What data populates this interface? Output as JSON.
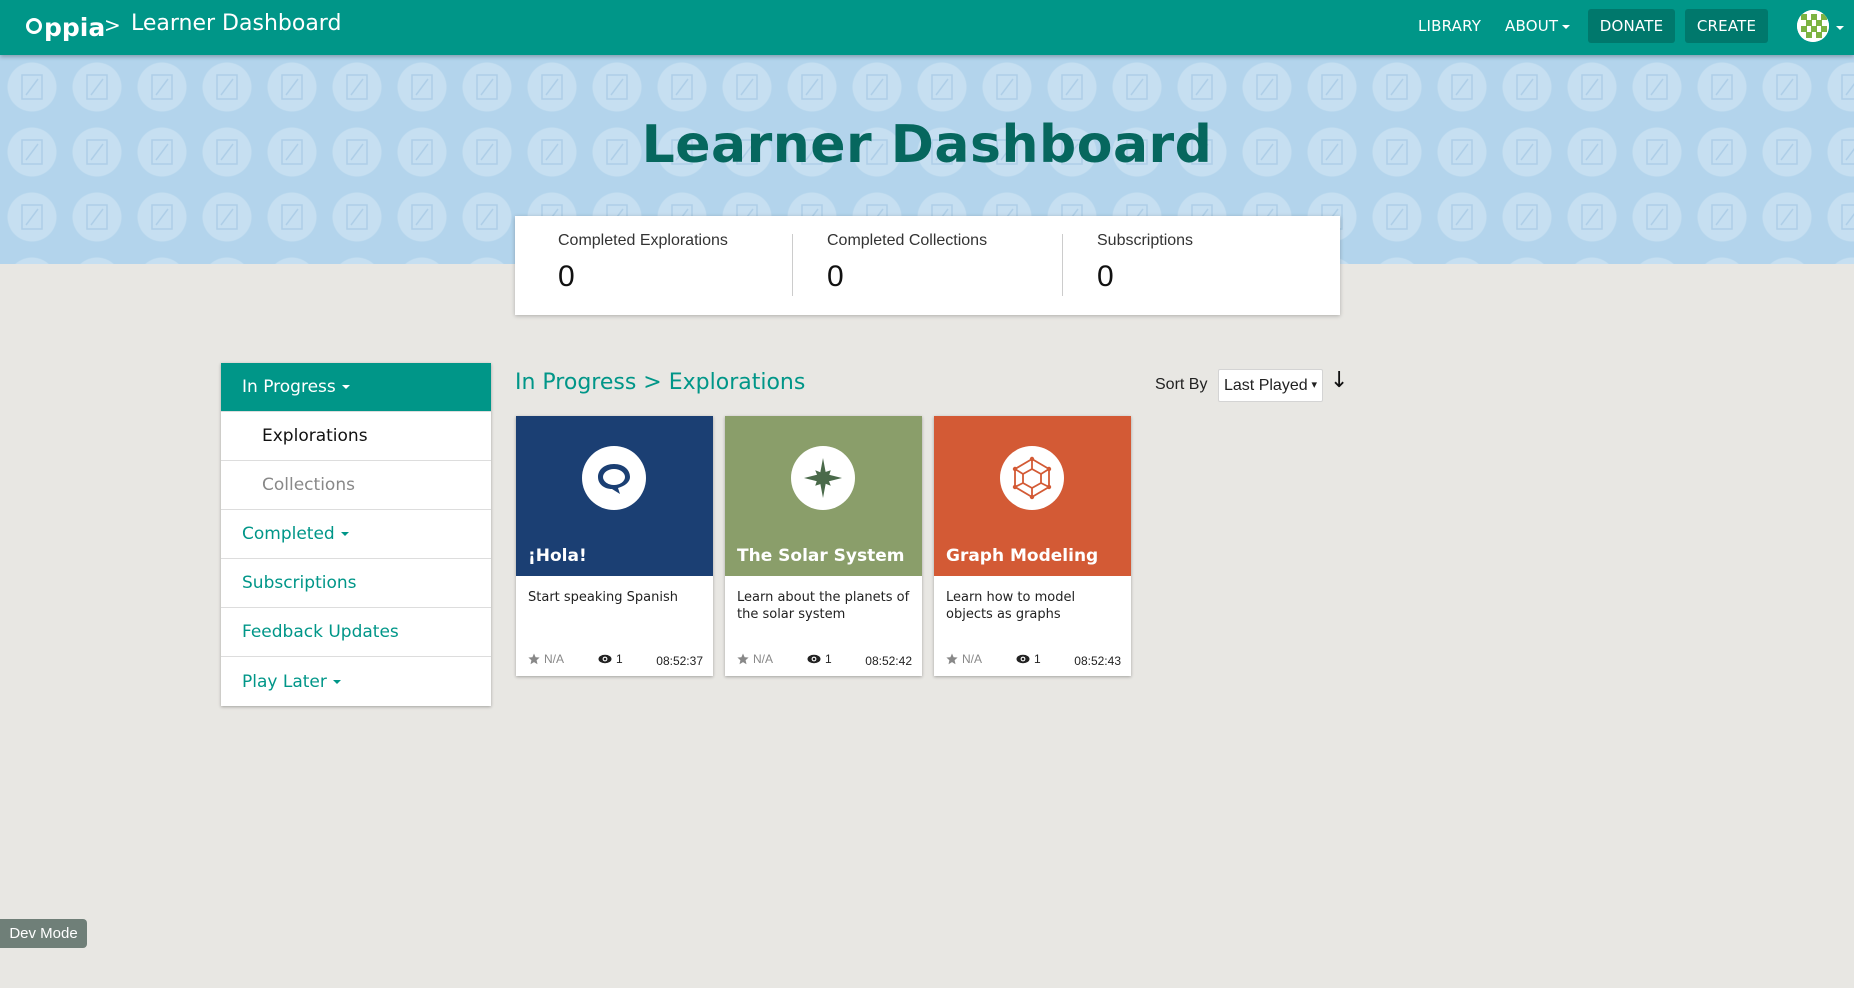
{
  "header": {
    "logo_text": "ppia",
    "breadcrumb_separator": ">",
    "breadcrumb_title": "Learner Dashboard",
    "nav": {
      "library": "LIBRARY",
      "about": "ABOUT",
      "donate": "DONATE",
      "create": "CREATE"
    }
  },
  "banner": {
    "title": "Learner Dashboard"
  },
  "stats": [
    {
      "label": "Completed Explorations",
      "value": "0"
    },
    {
      "label": "Completed Collections",
      "value": "0"
    },
    {
      "label": "Subscriptions",
      "value": "0"
    }
  ],
  "sidebar": {
    "items": [
      {
        "label": "In Progress"
      },
      {
        "label": "Explorations"
      },
      {
        "label": "Collections"
      },
      {
        "label": "Completed"
      },
      {
        "label": "Subscriptions"
      },
      {
        "label": "Feedback Updates"
      },
      {
        "label": "Play Later"
      }
    ]
  },
  "main": {
    "section_title": "In Progress > Explorations",
    "sort_label": "Sort By",
    "sort_value": "Last Played",
    "sort_dropdown": "▾",
    "sort_direction": "↓"
  },
  "cards": [
    {
      "title": "¡Hola!",
      "description": "Start speaking Spanish",
      "rating": "N/A",
      "views": "1",
      "time": "08:52:37",
      "color": "#1b3f73",
      "icon": "speech-bubble-icon"
    },
    {
      "title": "The Solar System",
      "description": "Learn about the planets of the solar system",
      "rating": "N/A",
      "views": "1",
      "time": "08:52:42",
      "color": "#8a9e6a",
      "icon": "star-icon"
    },
    {
      "title": "Graph Modeling",
      "description": "Learn how to model objects as graphs",
      "rating": "N/A",
      "views": "1",
      "time": "08:52:43",
      "color": "#d35a35",
      "icon": "graph-polyhedron-icon"
    }
  ],
  "dev_mode": "Dev Mode"
}
